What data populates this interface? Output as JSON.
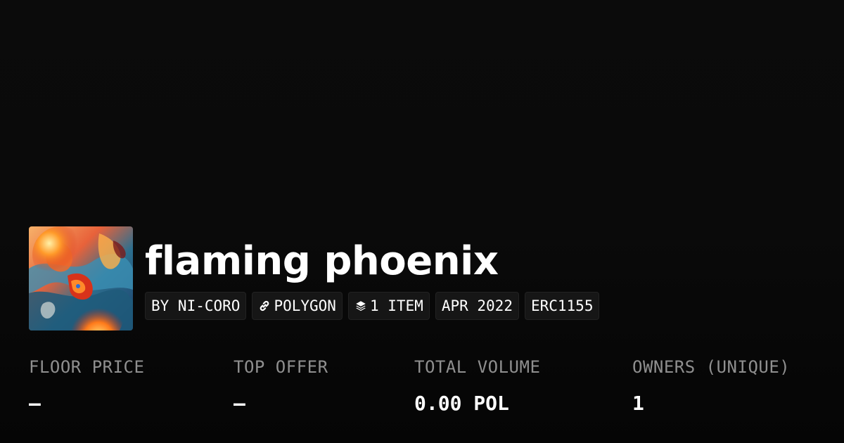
{
  "collection": {
    "title": "flaming phoenix",
    "image_icon": "phoenix-artwork"
  },
  "chips": {
    "creator": "BY NI-CORO",
    "chain": "POLYGON",
    "chain_icon": "link-icon",
    "items": "1 ITEM",
    "items_icon": "layers-icon",
    "date": "APR 2022",
    "standard": "ERC1155"
  },
  "stats": {
    "floor_price": {
      "label": "FLOOR PRICE",
      "value": "–"
    },
    "top_offer": {
      "label": "TOP OFFER",
      "value": "–"
    },
    "total_volume": {
      "label": "TOTAL VOLUME",
      "value": "0.00 POL"
    },
    "owners": {
      "label": "OWNERS (UNIQUE)",
      "value": "1"
    }
  },
  "colors": {
    "background": "#0a0a0a",
    "chip_background": "#161616",
    "label": "#8f8f8f",
    "text": "#ffffff"
  }
}
